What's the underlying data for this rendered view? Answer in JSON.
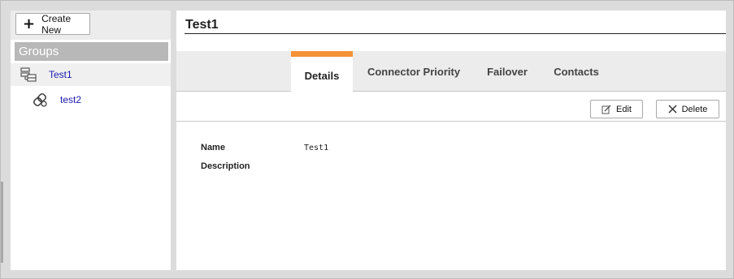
{
  "sidebar": {
    "create_label": "Create New",
    "groups_header": "Groups",
    "items": [
      {
        "label": "Test1",
        "icon": "server-stack-icon",
        "selected": true
      },
      {
        "label": "test2",
        "icon": "connector-group-icon",
        "selected": false
      }
    ]
  },
  "main": {
    "title": "Test1",
    "tabs": [
      {
        "label": "Details",
        "active": true
      },
      {
        "label": "Connector Priority",
        "active": false
      },
      {
        "label": "Failover",
        "active": false
      },
      {
        "label": "Contacts",
        "active": false
      }
    ],
    "actions": {
      "edit_label": "Edit",
      "delete_label": "Delete"
    },
    "fields": [
      {
        "label": "Name",
        "value": "Test1"
      },
      {
        "label": "Description",
        "value": ""
      }
    ]
  },
  "colors": {
    "accent": "#f39236",
    "link": "#1a1ab0",
    "groups_header_bg": "#b8b8b8",
    "panel_bg": "#dcdcdc"
  }
}
